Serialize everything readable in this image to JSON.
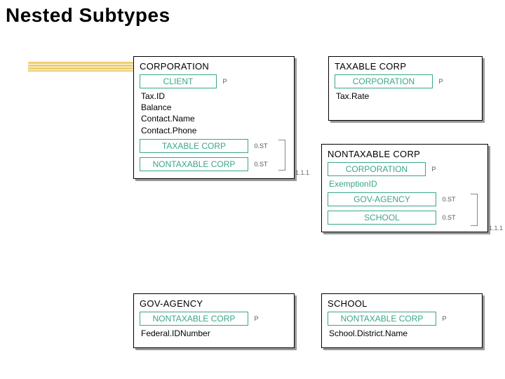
{
  "title": "Nested Subtypes",
  "entities": {
    "corporation": {
      "title": "CORPORATION",
      "parent": {
        "label": "CLIENT",
        "tag": "P"
      },
      "attrs": [
        "Tax.ID",
        "Balance",
        "Contact.Name",
        "Contact.Phone"
      ],
      "subtypes": [
        {
          "label": "TAXABLE CORP",
          "tag": "0.ST"
        },
        {
          "label": "NONTAXABLE CORP",
          "tag": "0.ST"
        }
      ],
      "group_tag": "1.1.1"
    },
    "taxable": {
      "title": "TAXABLE CORP",
      "parent": {
        "label": "CORPORATION",
        "tag": "P"
      },
      "attrs": [
        "Tax.Rate"
      ]
    },
    "nontaxable": {
      "title": "NONTAXABLE CORP",
      "parent": {
        "label": "CORPORATION",
        "tag": "P"
      },
      "attrs": [
        "ExemptionID"
      ],
      "subtypes": [
        {
          "label": "GOV-AGENCY",
          "tag": "0.ST"
        },
        {
          "label": "SCHOOL",
          "tag": "0.ST"
        }
      ],
      "group_tag": "1.1.1"
    },
    "govagency": {
      "title": "GOV-AGENCY",
      "parent": {
        "label": "NONTAXABLE CORP",
        "tag": "P"
      },
      "attrs": [
        "Federal.IDNumber"
      ]
    },
    "school": {
      "title": "SCHOOL",
      "parent": {
        "label": "NONTAXABLE CORP",
        "tag": "P"
      },
      "attrs": [
        "School.District.Name"
      ]
    }
  }
}
